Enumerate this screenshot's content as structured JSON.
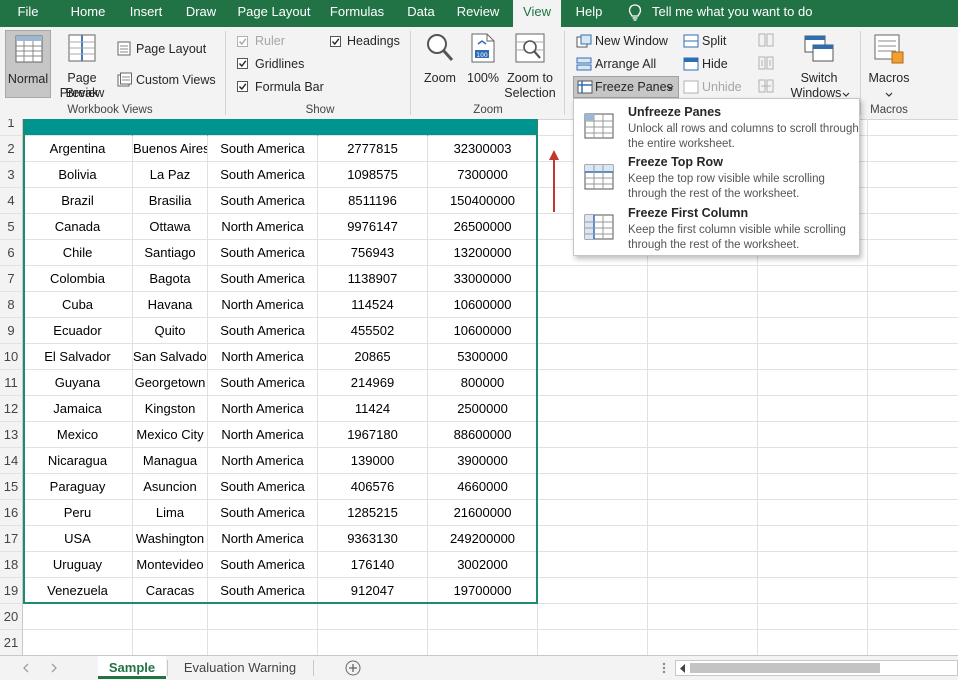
{
  "ribbon_tabs": [
    "File",
    "Home",
    "Insert",
    "Draw",
    "Page Layout",
    "Formulas",
    "Data",
    "Review",
    "View",
    "Help"
  ],
  "tell_me": "Tell me what you want to do",
  "workbook_views": {
    "normal": "Normal",
    "page_break_1": "Page Break",
    "page_break_2": "Preview",
    "page_layout": "Page Layout",
    "custom_views": "Custom Views",
    "label": "Workbook Views"
  },
  "show": {
    "ruler": "Ruler",
    "gridlines": "Gridlines",
    "formula_bar": "Formula Bar",
    "headings": "Headings",
    "label": "Show"
  },
  "zoom": {
    "zoom": "Zoom",
    "hundred": "100%",
    "to_selection_1": "Zoom to",
    "to_selection_2": "Selection",
    "label": "Zoom"
  },
  "window": {
    "new_window": "New Window",
    "arrange_all": "Arrange All",
    "freeze_panes": "Freeze Panes",
    "split": "Split",
    "hide": "Hide",
    "unhide": "Unhide",
    "switch_1": "Switch",
    "switch_2": "Windows"
  },
  "macros": {
    "macros": "Macros",
    "label": "Macros"
  },
  "freeze_menu": [
    {
      "title": "Unfreeze Panes",
      "desc": "Unlock all rows and columns to scroll through the entire worksheet."
    },
    {
      "title": "Freeze Top Row",
      "desc": "Keep the top row visible while scrolling through the rest of the worksheet."
    },
    {
      "title": "Freeze First Column",
      "desc": "Keep the first column visible while scrolling through the rest of the worksheet."
    }
  ],
  "row_numbers": [
    "1",
    "2",
    "3",
    "4",
    "5",
    "6",
    "7",
    "8",
    "9",
    "10",
    "11",
    "12",
    "13",
    "14",
    "15",
    "16",
    "17",
    "18",
    "19",
    "20",
    "21"
  ],
  "rows": [
    [
      "Argentina",
      "Buenos Aires",
      "South America",
      "2777815",
      "32300003"
    ],
    [
      "Bolivia",
      "La Paz",
      "South America",
      "1098575",
      "7300000"
    ],
    [
      "Brazil",
      "Brasilia",
      "South America",
      "8511196",
      "150400000"
    ],
    [
      "Canada",
      "Ottawa",
      "North America",
      "9976147",
      "26500000"
    ],
    [
      "Chile",
      "Santiago",
      "South America",
      "756943",
      "13200000"
    ],
    [
      "Colombia",
      "Bagota",
      "South America",
      "1138907",
      "33000000"
    ],
    [
      "Cuba",
      "Havana",
      "North America",
      "114524",
      "10600000"
    ],
    [
      "Ecuador",
      "Quito",
      "South America",
      "455502",
      "10600000"
    ],
    [
      "El Salvador",
      "San Salvador",
      "North America",
      "20865",
      "5300000"
    ],
    [
      "Guyana",
      "Georgetown",
      "South America",
      "214969",
      "800000"
    ],
    [
      "Jamaica",
      "Kingston",
      "North America",
      "11424",
      "2500000"
    ],
    [
      "Mexico",
      "Mexico City",
      "North America",
      "1967180",
      "88600000"
    ],
    [
      "Nicaragua",
      "Managua",
      "North America",
      "139000",
      "3900000"
    ],
    [
      "Paraguay",
      "Asuncion",
      "South America",
      "406576",
      "4660000"
    ],
    [
      "Peru",
      "Lima",
      "South America",
      "1285215",
      "21600000"
    ],
    [
      "USA",
      "Washington",
      "North America",
      "9363130",
      "249200000"
    ],
    [
      "Uruguay",
      "Montevideo",
      "South America",
      "176140",
      "3002000"
    ],
    [
      "Venezuela",
      "Caracas",
      "South America",
      "912047",
      "19700000"
    ]
  ],
  "sheets": [
    "Sample",
    "Evaluation Warning"
  ],
  "colors": {
    "accent": "#217346",
    "header_fill": "#00948f",
    "table_border": "#1e8a72",
    "arrow": "#c0392b"
  }
}
